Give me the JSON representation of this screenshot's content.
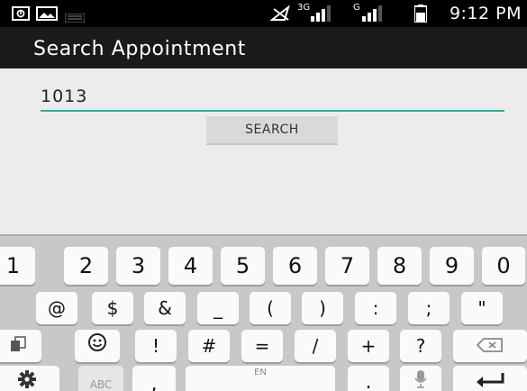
{
  "status_bar": {
    "time": "9:12 PM",
    "network_1": "3G",
    "network_2": "G",
    "icons": [
      "notification-icon",
      "image-icon",
      "keyboard-notification-icon",
      "airplane-signal-icon",
      "signal-3g-icon",
      "signal-g-icon",
      "battery-icon"
    ]
  },
  "app_bar": {
    "title": "Search Appointment"
  },
  "search": {
    "input_value": "1013",
    "button_label": "SEARCH"
  },
  "keyboard": {
    "number_row": [
      "1",
      "2",
      "3",
      "4",
      "5",
      "6",
      "7",
      "8",
      "9",
      "0"
    ],
    "symbol_row": [
      "@",
      "$",
      "&",
      "_",
      "(",
      ")",
      ":",
      ";",
      "\""
    ],
    "third_row": [
      "!",
      "#",
      "=",
      "/",
      "+",
      "?"
    ],
    "abc_label": "ABC",
    "comma": ",",
    "space_label": "EN",
    "period": ".",
    "icons": [
      "clipboard-icon",
      "emoji-icon",
      "backspace-icon",
      "settings-icon",
      "microphone-icon",
      "enter-icon"
    ]
  },
  "colors": {
    "status_bar": "#000000",
    "app_bar": "#1a1a1a",
    "accent_underline": "#3aa7a0",
    "background": "#ececec",
    "keyboard": "#c8c8c8"
  }
}
